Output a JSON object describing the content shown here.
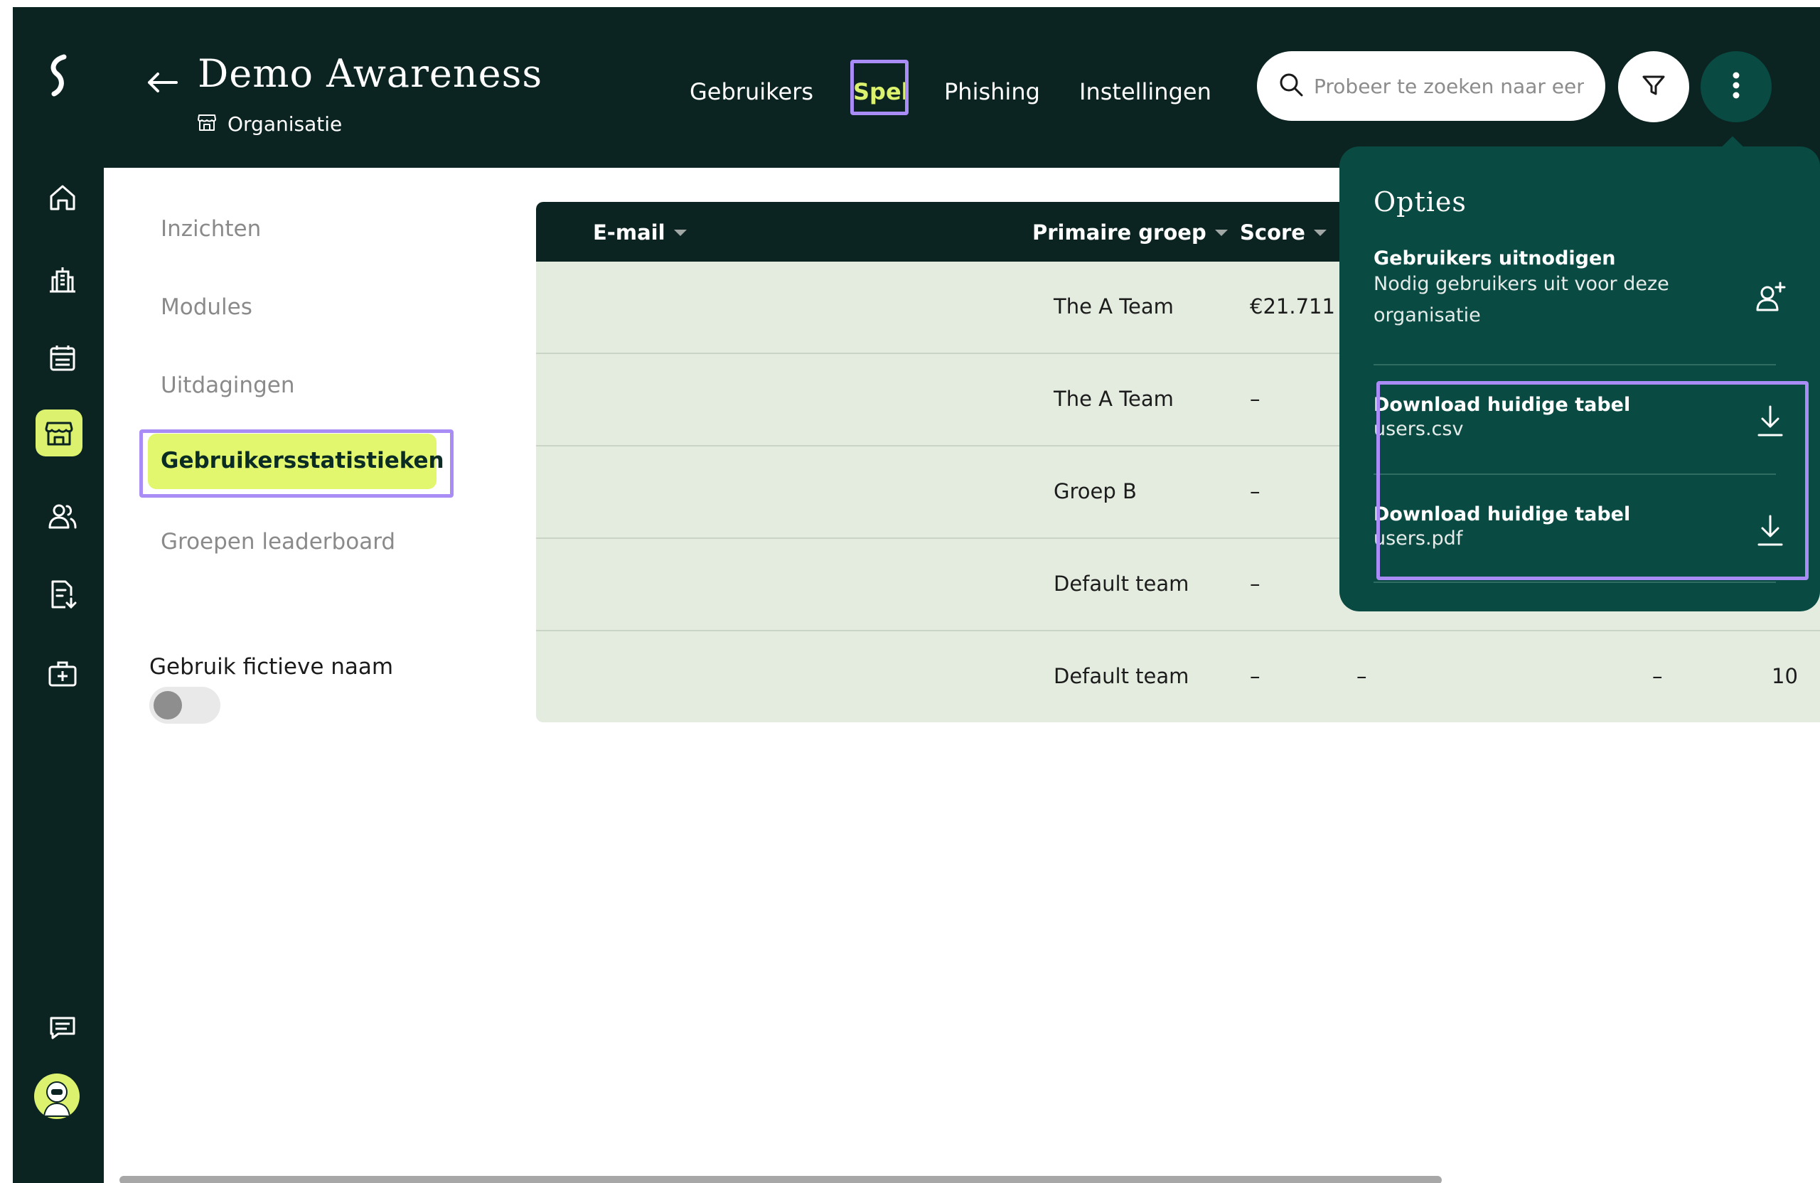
{
  "header": {
    "title": "Demo Awareness",
    "subtitle": "Organisatie",
    "nav": [
      "Gebruikers",
      "Spel",
      "Phishing",
      "Instellingen"
    ],
    "active_nav": "Spel",
    "search_placeholder": "Probeer te zoeken naar een r"
  },
  "sidebar_icons": [
    "home-icon",
    "building-icon",
    "calendar-icon",
    "store-icon",
    "users-icon",
    "document-icon",
    "first-aid-icon",
    "chat-icon",
    "avatar"
  ],
  "left_menu": {
    "items": [
      "Inzichten",
      "Modules",
      "Uitdagingen",
      "Gebruikersstatistieken",
      "Groepen leaderboard"
    ],
    "active": "Gebruikersstatistieken",
    "fictive_name_label": "Gebruik fictieve naam",
    "fictive_name_enabled": false
  },
  "table": {
    "columns": [
      "E-mail",
      "Primaire groep",
      "Score"
    ],
    "rows": [
      {
        "group": "The A Team",
        "score": "€21.711",
        "c4": "",
        "c5": "",
        "c6": ""
      },
      {
        "group": "The A Team",
        "score": "–",
        "c4": "",
        "c5": "",
        "c6": ""
      },
      {
        "group": "Groep B",
        "score": "–",
        "c4": "",
        "c5": "",
        "c6": ""
      },
      {
        "group": "Default team",
        "score": "–",
        "c4": "",
        "c5": "",
        "c6": ""
      },
      {
        "group": "Default team",
        "score": "–",
        "c4": "–",
        "c5": "–",
        "c6": "10"
      }
    ]
  },
  "options": {
    "title": "Opties",
    "invite_title": "Gebruikers uitnodigen",
    "invite_sub_1": "Nodig gebruikers uit voor deze",
    "invite_sub_2": "organisatie",
    "csv_title": "Download huidige tabel",
    "csv_file": "users.csv",
    "pdf_title": "Download huidige tabel",
    "pdf_file": "users.pdf"
  },
  "colors": {
    "dark": "#0b2421",
    "accent": "#dcf26f",
    "popup": "#094a42",
    "highlight": "#a98cf5",
    "table_bg": "#e3ecdf"
  }
}
